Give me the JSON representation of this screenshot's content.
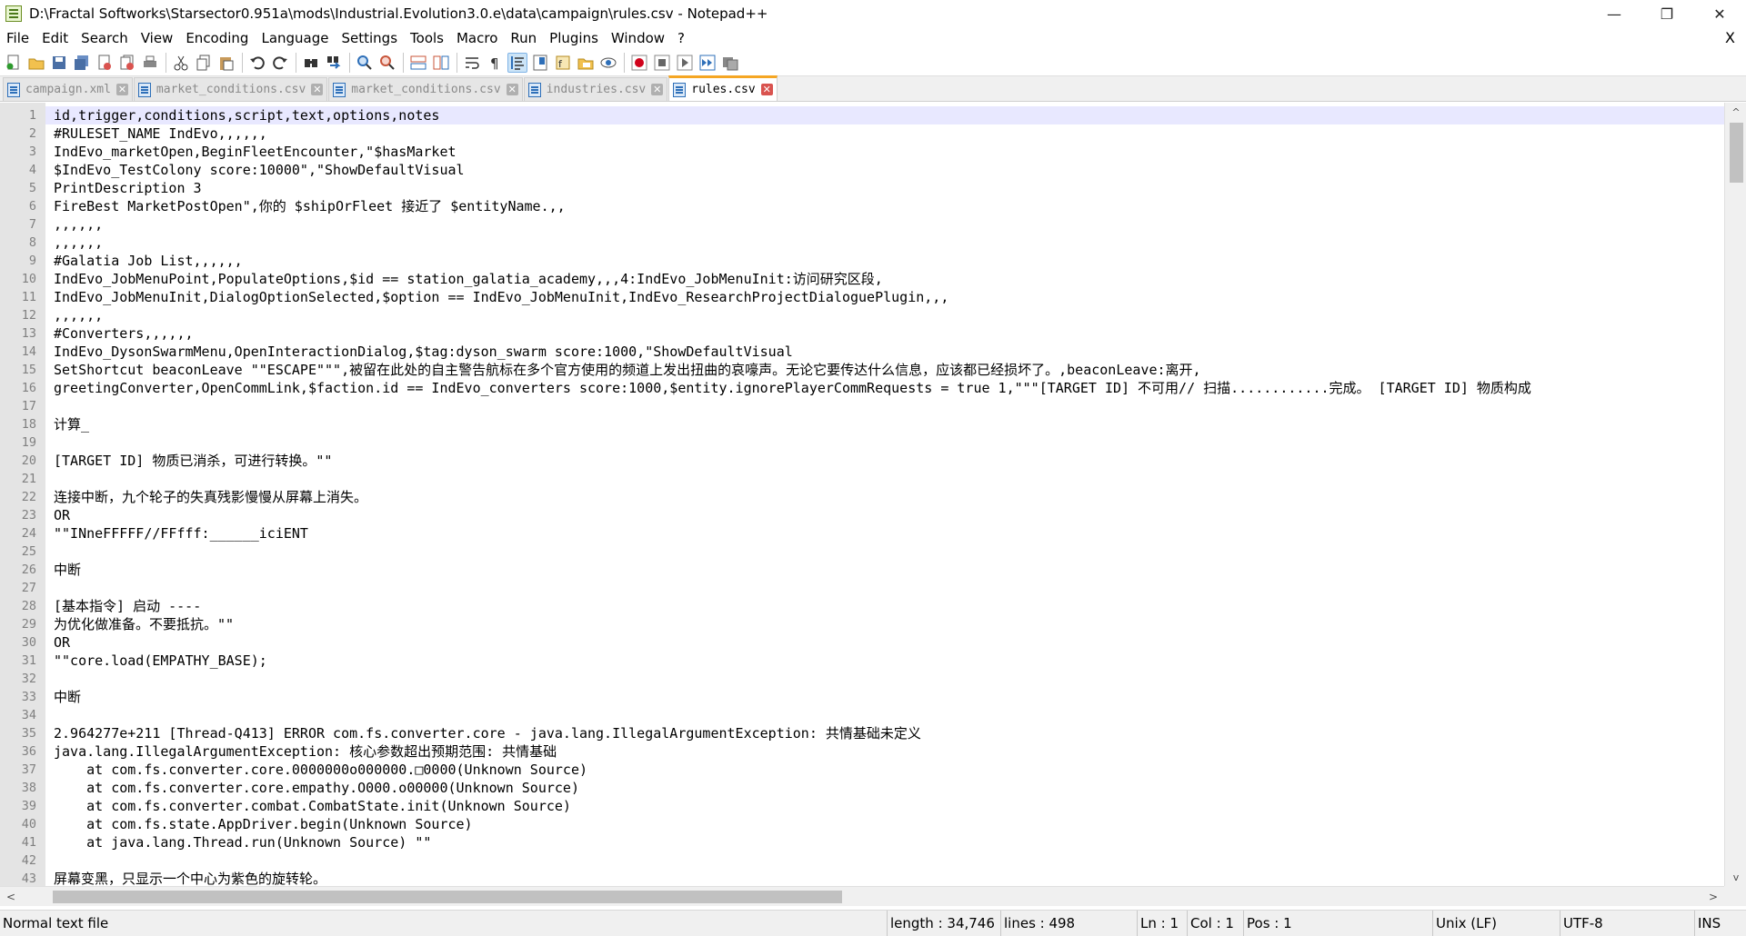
{
  "window": {
    "title": "D:\\Fractal Softworks\\Starsector0.951a\\mods\\Industrial.Evolution3.0.e\\data\\campaign\\rules.csv - Notepad++",
    "minimize_glyph": "—",
    "maximize_glyph": "❐",
    "close_glyph": "✕"
  },
  "menu": {
    "items": [
      "File",
      "Edit",
      "Search",
      "View",
      "Encoding",
      "Language",
      "Settings",
      "Tools",
      "Macro",
      "Run",
      "Plugins",
      "Window",
      "?"
    ],
    "close_glyph": "X"
  },
  "toolbar": {
    "icons": [
      "new-file-icon",
      "open-file-icon",
      "save-icon",
      "save-all-icon",
      "close-icon",
      "close-all-icon",
      "print-icon",
      "cut-icon",
      "copy-icon",
      "paste-icon",
      "undo-icon",
      "redo-icon",
      "find-icon",
      "replace-icon",
      "zoom-in-icon",
      "zoom-out-icon",
      "sync-vertical-icon",
      "sync-horizontal-icon",
      "word-wrap-icon",
      "show-all-chars-icon",
      "indent-guide-icon",
      "document-map-icon",
      "function-list-icon",
      "folder-as-workspace-icon",
      "monitoring-icon",
      "record-macro-icon",
      "stop-macro-icon",
      "play-macro-icon",
      "run-macro-multiple-icon",
      "save-macro-icon"
    ]
  },
  "tabs": [
    {
      "label": "campaign.xml",
      "active": false
    },
    {
      "label": "market_conditions.csv",
      "active": false
    },
    {
      "label": "market_conditions.csv",
      "active": false
    },
    {
      "label": "industries.csv",
      "active": false
    },
    {
      "label": "rules.csv",
      "active": true
    }
  ],
  "editor": {
    "lines": [
      "id,trigger,conditions,script,text,options,notes",
      "#RULESET_NAME IndEvo,,,,,,",
      "IndEvo_marketOpen,BeginFleetEncounter,\"$hasMarket",
      "$IndEvo_TestColony score:10000\",\"ShowDefaultVisual",
      "PrintDescription 3",
      "FireBest MarketPostOpen\",你的 $shipOrFleet 接近了 $entityName.,,",
      ",,,,,,",
      ",,,,,,",
      "#Galatia Job List,,,,,,",
      "IndEvo_JobMenuPoint,PopulateOptions,$id == station_galatia_academy,,,4:IndEvo_JobMenuInit:访问研究区段,",
      "IndEvo_JobMenuInit,DialogOptionSelected,$option == IndEvo_JobMenuInit,IndEvo_ResearchProjectDialoguePlugin,,,",
      ",,,,,,",
      "#Converters,,,,,,",
      "IndEvo_DysonSwarmMenu,OpenInteractionDialog,$tag:dyson_swarm score:1000,\"ShowDefaultVisual",
      "SetShortcut beaconLeave \"\"ESCAPE\"\"\",被留在此处的自主警告航标在多个官方使用的频道上发出扭曲的哀嚎声。无论它要传达什么信息，应该都已经损坏了。,beaconLeave:离开,",
      "greetingConverter,OpenCommLink,$faction.id == IndEvo_converters score:1000,$entity.ignorePlayerCommRequests = true 1,\"\"\"[TARGET ID] 不可用// 扫描............完成。 [TARGET ID] 物质构成",
      "",
      "计算_",
      "",
      "[TARGET ID] 物质已消杀，可进行转换。\"\"",
      "",
      "连接中断，九个轮子的失真残影慢慢从屏幕上消失。",
      "OR",
      "\"\"INneFFFFF//FFfff:______iciENT",
      "",
      "中断",
      "",
      "[基本指令] 启动 ----",
      "为优化做准备。不要抵抗。\"\"",
      "OR",
      "\"\"core.load(EMPATHY_BASE);",
      "",
      "中断",
      "",
      "2.964277e+211 [Thread-Q413] ERROR com.fs.converter.core - java.lang.IllegalArgumentException: 共情基础未定义",
      "java.lang.IllegalArgumentException: 核心参数超出预期范围: 共情基础",
      "    at com.fs.converter.core.0000000o000000.□0000(Unknown Source)",
      "    at com.fs.converter.core.empathy.O000.o00000(Unknown Source)",
      "    at com.fs.converter.combat.CombatState.init(Unknown Source)",
      "    at com.fs.state.AppDriver.begin(Unknown Source)",
      "    at java.lang.Thread.run(Unknown Source) \"\"",
      "",
      "屏幕变黑，只显示一个中心为紫色的旋转轮。"
    ],
    "line_numbers": [
      "1",
      "2",
      "3",
      "4",
      "5",
      "6",
      "7",
      "8",
      "9",
      "10",
      "11",
      "12",
      "13",
      "14",
      "15",
      "16",
      "17",
      "18",
      "19",
      "20",
      "21",
      "22",
      "23",
      "24",
      "25",
      "26",
      "27",
      "28",
      "29",
      "30",
      "31",
      "32",
      "33",
      "34",
      "35",
      "36",
      "37",
      "38",
      "39",
      "40",
      "41",
      "42",
      "43"
    ]
  },
  "scrollbars": {
    "up_glyph": "^",
    "down_glyph": "v",
    "left_glyph": "<",
    "right_glyph": ">"
  },
  "statusbar": {
    "file_type": "Normal text file",
    "length": "length : 34,746",
    "lines": "lines : 498",
    "ln": "Ln : 1",
    "col": "Col : 1",
    "pos": "Pos : 1",
    "eol": "Unix (LF)",
    "encoding": "UTF-8",
    "mode": "INS"
  },
  "colors": {
    "active_tab_accent": "#f5a623",
    "current_line": "#e8e8ff",
    "gutter": "#e4e4e4"
  }
}
